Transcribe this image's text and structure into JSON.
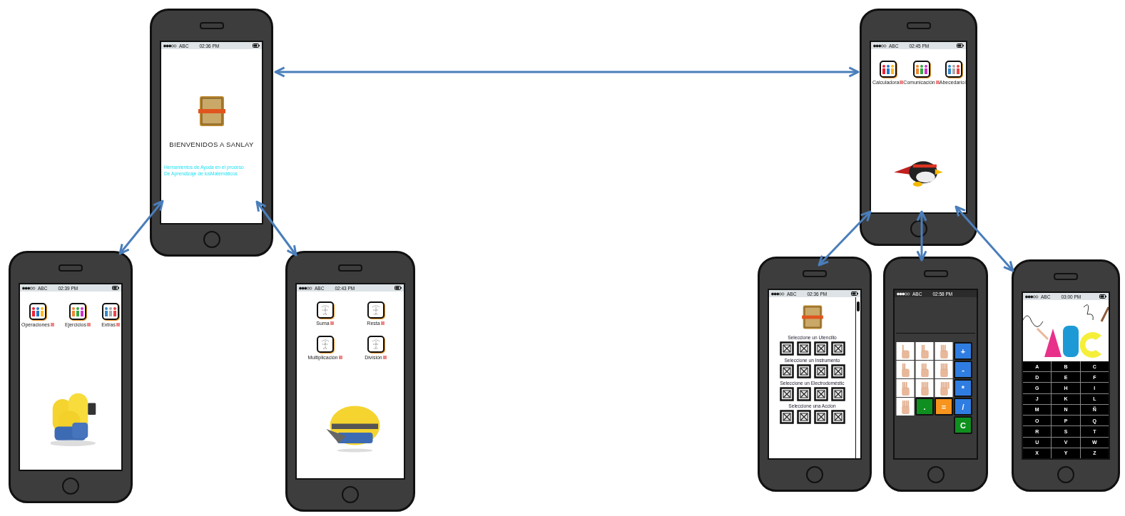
{
  "phones": [
    {
      "kind": "splash",
      "status": {
        "carrier": "ABC",
        "time": "02:36 PM"
      },
      "title": "BIENVENIDOS A SANLAY",
      "subtitle": [
        "Herramientos de Ayuda en el proceso",
        "De Aprendizaje de losMatemáticos"
      ]
    },
    {
      "kind": "menu",
      "status": {
        "carrier": "ABC",
        "time": "02:39 PM"
      },
      "items": [
        "Operaciones",
        "Ejercicios",
        "Extras"
      ],
      "picture": {
        "kind": "picture"
      }
    },
    {
      "kind": "operations",
      "status": {
        "carrier": "ABC",
        "time": "02:43 PM"
      },
      "items": [
        "Suma",
        "Resta",
        "Multiplicación",
        "División"
      ],
      "picture": {
        "kind": "picture"
      }
    },
    {
      "kind": "menu",
      "status": {
        "carrier": "ABC",
        "time": "02:45 PM"
      },
      "items": [
        "Calculadora",
        "Comunicación",
        "Abecedario"
      ],
      "picture": {
        "kind": "picture"
      }
    },
    {
      "kind": "selection",
      "status": {
        "carrier": "ABC",
        "time": "02:36 PM"
      },
      "sections": [
        "Seleccione un Utencillo",
        "Seleccione un Instrumento",
        "Seleccione un Electrodoméstic",
        "Seleccione una Accion"
      ]
    },
    {
      "kind": "calculator",
      "status": {
        "carrier": "ABC",
        "time": "02:58 PM"
      },
      "keys": [
        {
          "kind": "hand"
        },
        {
          "kind": "hand"
        },
        {
          "kind": "hand"
        },
        {
          "kind": "op",
          "label": "+",
          "color": "#2f7de1"
        },
        {
          "kind": "hand"
        },
        {
          "kind": "hand"
        },
        {
          "kind": "hand"
        },
        {
          "kind": "op",
          "label": "-",
          "color": "#2f7de1"
        },
        {
          "kind": "hand"
        },
        {
          "kind": "hand"
        },
        {
          "kind": "hand"
        },
        {
          "kind": "op",
          "label": "*",
          "color": "#2f7de1"
        },
        {
          "kind": "hand"
        },
        {
          "kind": "op",
          "label": ".",
          "color": "#0f8f1f"
        },
        {
          "kind": "op",
          "label": "=",
          "color": "#f7941d"
        },
        {
          "kind": "op",
          "label": "/",
          "color": "#2f7de1"
        },
        {
          "kind": "op",
          "label": "C",
          "color": "#0f8f1f"
        }
      ]
    },
    {
      "kind": "alphabet",
      "status": {
        "carrier": "ABC",
        "time": "03:00 PM"
      },
      "picture": {
        "kind": "picture"
      },
      "letters": [
        "A",
        "B",
        "C",
        "D",
        "E",
        "F",
        "G",
        "H",
        "I",
        "J",
        "K",
        "L",
        "M",
        "N",
        "Ñ",
        "O",
        "P",
        "Q",
        "R",
        "S",
        "T",
        "U",
        "V",
        "W",
        "X",
        "Y",
        "Z"
      ]
    }
  ]
}
